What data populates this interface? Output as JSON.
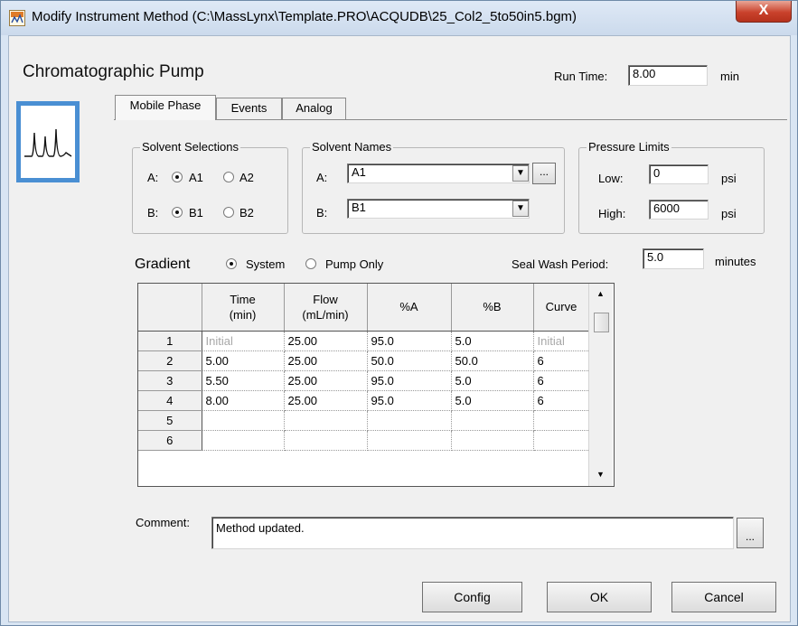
{
  "window": {
    "title": "Modify Instrument Method (C:\\MassLynx\\Template.PRO\\ACQUDB\\25_Col2_5to50in5.bgm)",
    "close_label": "X"
  },
  "heading": "Chromatographic Pump",
  "run_time": {
    "label": "Run Time:",
    "value": "8.00",
    "unit": "min"
  },
  "tabs": [
    {
      "label": "Mobile Phase",
      "active": true
    },
    {
      "label": "Events",
      "active": false
    },
    {
      "label": "Analog",
      "active": false
    }
  ],
  "solvent_selections": {
    "title": "Solvent Selections",
    "row_a": {
      "label": "A:",
      "opt1": "A1",
      "opt2": "A2",
      "selected": "A1"
    },
    "row_b": {
      "label": "B:",
      "opt1": "B1",
      "opt2": "B2",
      "selected": "B1"
    }
  },
  "solvent_names": {
    "title": "Solvent Names",
    "a_label": "A:",
    "a_value": "A1",
    "b_label": "B:",
    "b_value": "B1",
    "browse_label": "..."
  },
  "pressure_limits": {
    "title": "Pressure Limits",
    "low_label": "Low:",
    "low_value": "0",
    "high_label": "High:",
    "high_value": "6000",
    "unit": "psi"
  },
  "gradient": {
    "label": "Gradient",
    "opt_system": "System",
    "opt_pump_only": "Pump Only",
    "selected": "System"
  },
  "seal_wash": {
    "label": "Seal Wash Period:",
    "value": "5.0",
    "unit": "minutes"
  },
  "table": {
    "columns": [
      "",
      "Time\n(min)",
      "Flow\n(mL/min)",
      "%A",
      "%B",
      "Curve"
    ],
    "rows": [
      {
        "n": "1",
        "time": "Initial",
        "flow": "25.00",
        "a": "95.0",
        "b": "5.0",
        "curve": "Initial"
      },
      {
        "n": "2",
        "time": "5.00",
        "flow": "25.00",
        "a": "50.0",
        "b": "50.0",
        "curve": "6"
      },
      {
        "n": "3",
        "time": "5.50",
        "flow": "25.00",
        "a": "95.0",
        "b": "5.0",
        "curve": "6"
      },
      {
        "n": "4",
        "time": "8.00",
        "flow": "25.00",
        "a": "95.0",
        "b": "5.0",
        "curve": "6"
      },
      {
        "n": "5",
        "time": "",
        "flow": "",
        "a": "",
        "b": "",
        "curve": ""
      },
      {
        "n": "6",
        "time": "",
        "flow": "",
        "a": "",
        "b": "",
        "curve": ""
      }
    ]
  },
  "comment": {
    "label": "Comment:",
    "value": "Method updated.",
    "browse_label": "..."
  },
  "buttons": {
    "config": "Config",
    "ok": "OK",
    "cancel": "Cancel"
  },
  "icons": {
    "title_icon": "instrument-method-icon",
    "pump_icon": "chromatogram-peaks-icon",
    "scroll_up": "scroll-up-arrow-icon",
    "scroll_down": "scroll-down-arrow-icon",
    "dropdown": "chevron-down-icon"
  },
  "colors": {
    "close_button": "#c9422c",
    "icon_border": "#4a8fd3",
    "disabled_text": "#a8a8a8"
  }
}
